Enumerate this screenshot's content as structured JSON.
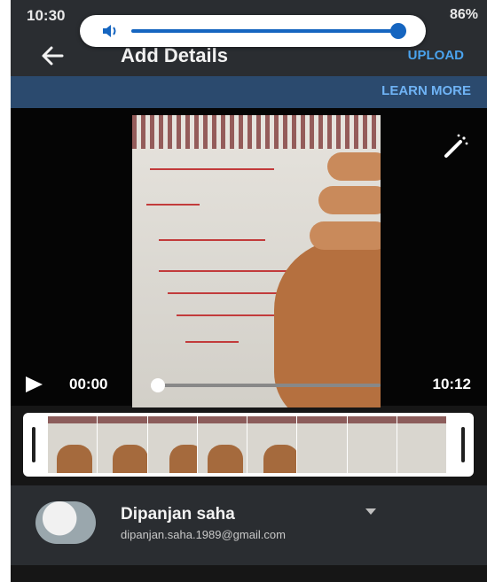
{
  "status_bar": {
    "time": "10:30",
    "battery": "86%"
  },
  "volume": {
    "level": 0.97
  },
  "app_bar": {
    "title": "Add Details",
    "upload_label": "UPLOAD",
    "back_icon": "arrow-left-icon"
  },
  "banner": {
    "learn_more_label": "LEARN MORE"
  },
  "player": {
    "current_time": "00:00",
    "total_time": "10:12",
    "progress": 0.0,
    "play_icon": "play-icon",
    "enhance_icon": "magic-wand-icon"
  },
  "trim": {
    "frames": 8
  },
  "account": {
    "name": "Dipanjan saha",
    "email": "dipanjan.saha.1989@gmail.com",
    "dropdown_icon": "caret-down-icon"
  },
  "colors": {
    "accent": "#4aa3ee",
    "banner": "#2b4a6e",
    "bar": "#2a2d31"
  }
}
